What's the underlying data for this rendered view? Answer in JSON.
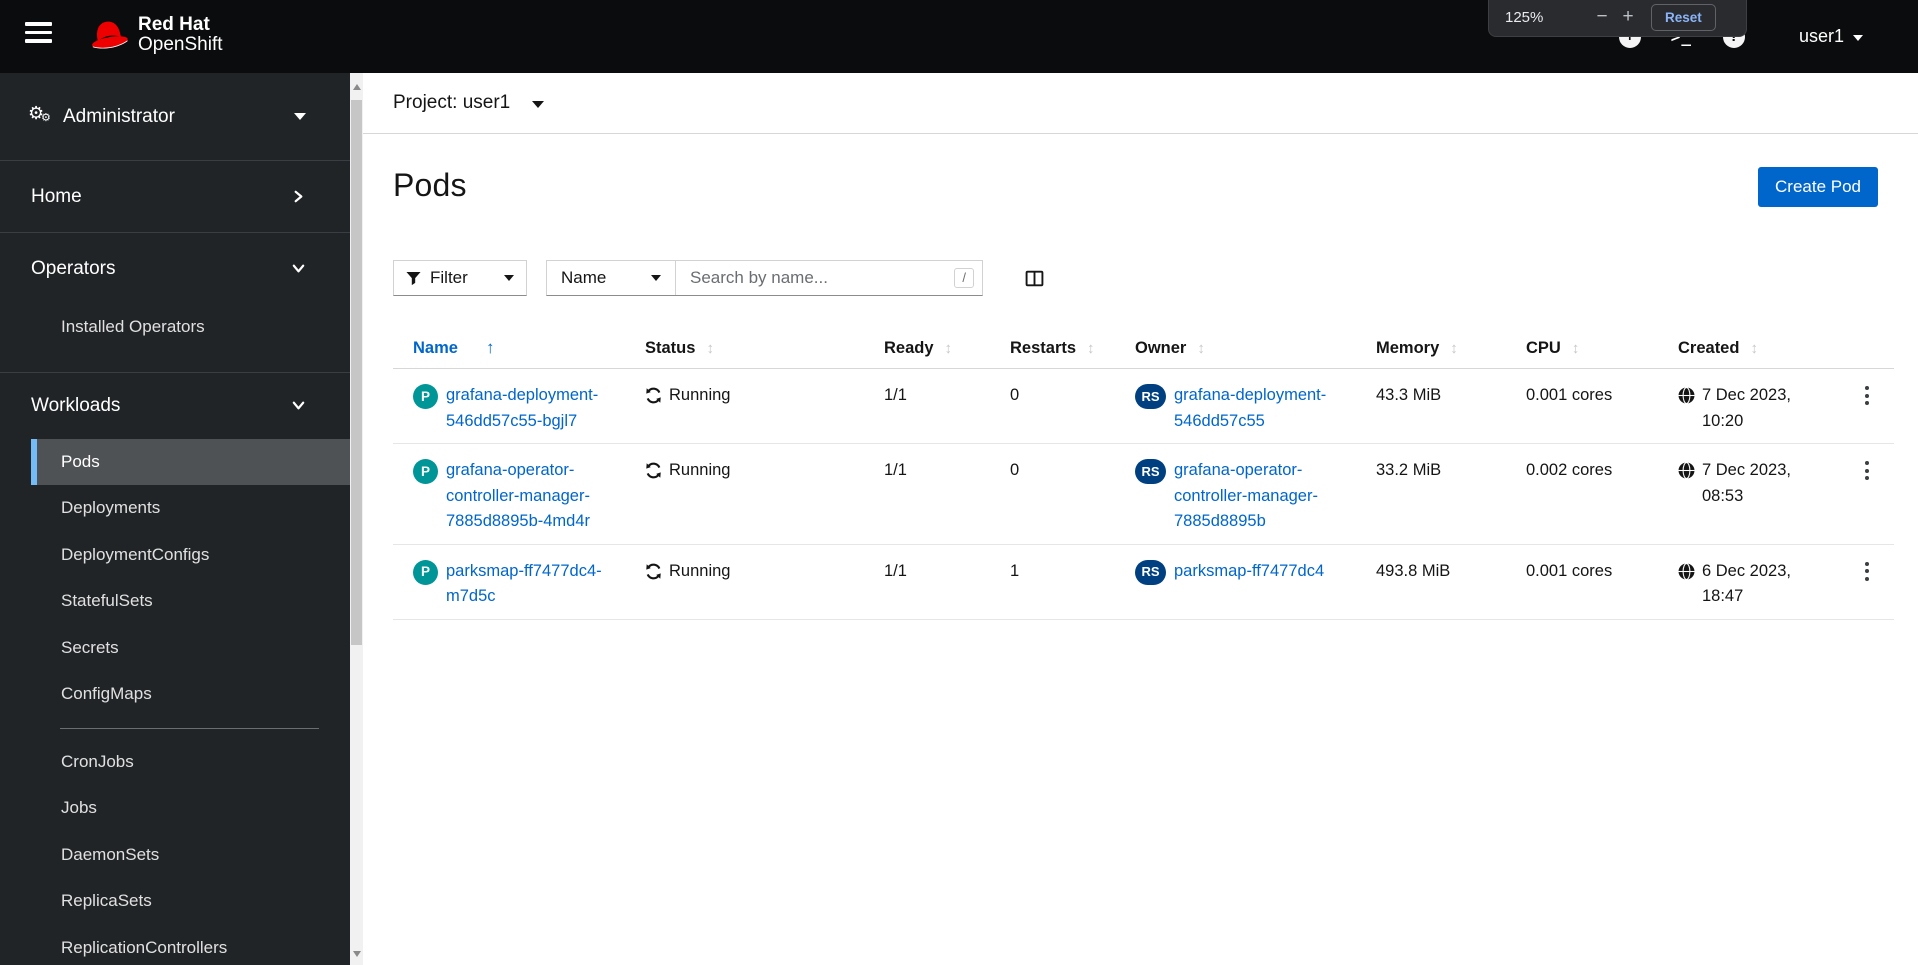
{
  "masthead": {
    "brand_line1": "Red Hat",
    "brand_line2": "OpenShift",
    "user_label": "user1"
  },
  "zoom_popup": {
    "level": "125%",
    "minus": "−",
    "plus": "+",
    "reset_label": "Reset"
  },
  "icons": {
    "quick_create_glyph": "+",
    "terminal_glyph": ">_",
    "help_glyph": "?",
    "gear_glyph": "⚙",
    "sort_inactive_glyph": "↕",
    "sort_ascending_glyph": "↑"
  },
  "sidebar": {
    "perspective_label": "Administrator",
    "home_label": "Home",
    "operators_label": "Operators",
    "operators_items": [
      "Installed Operators"
    ],
    "workloads_label": "Workloads",
    "workloads_items_group1": [
      "Pods",
      "Deployments",
      "DeploymentConfigs",
      "StatefulSets",
      "Secrets",
      "ConfigMaps"
    ],
    "workloads_items_group2": [
      "CronJobs",
      "Jobs",
      "DaemonSets",
      "ReplicaSets",
      "ReplicationControllers"
    ],
    "selected_item": "Pods"
  },
  "project_bar": {
    "label": "Project: user1"
  },
  "page": {
    "title": "Pods",
    "create_button_label": "Create Pod"
  },
  "toolbar": {
    "filter_label": "Filter",
    "name_filter_label": "Name",
    "search_placeholder": "Search by name...",
    "shortcut_hint": "/"
  },
  "table": {
    "columns": [
      "Name",
      "Status",
      "Ready",
      "Restarts",
      "Owner",
      "Memory",
      "CPU",
      "Created"
    ],
    "sorted_column": "Name",
    "sort_direction": "ascending",
    "rows": [
      {
        "badge": "P",
        "name": "grafana-deployment-546dd57c55-bgjl7",
        "status": "Running",
        "ready": "1/1",
        "restarts": "0",
        "owner_badge": "RS",
        "owner": "grafana-deployment-546dd57c55",
        "memory": "43.3 MiB",
        "cpu": "0.001 cores",
        "created_date": "7 Dec 2023,",
        "created_time": "10:20"
      },
      {
        "badge": "P",
        "name": "grafana-operator-controller-manager-7885d8895b-4md4r",
        "status": "Running",
        "ready": "1/1",
        "restarts": "0",
        "owner_badge": "RS",
        "owner": "grafana-operator-controller-manager-7885d8895b",
        "memory": "33.2 MiB",
        "cpu": "0.002 cores",
        "created_date": "7 Dec 2023,",
        "created_time": "08:53"
      },
      {
        "badge": "P",
        "name": "parksmap-ff7477dc4-m7d5c",
        "status": "Running",
        "ready": "1/1",
        "restarts": "1",
        "owner_badge": "RS",
        "owner": "parksmap-ff7477dc4",
        "memory": "493.8 MiB",
        "cpu": "0.001 cores",
        "created_date": "6 Dec 2023,",
        "created_time": "18:47"
      }
    ]
  },
  "colors": {
    "accent_blue": "#0066cc",
    "pod_badge": "#009596",
    "replicaset_badge": "#004080",
    "nav_selected_border": "#73bcf7",
    "masthead_bg": "#0b0c0d",
    "sidebar_bg": "#212427"
  }
}
